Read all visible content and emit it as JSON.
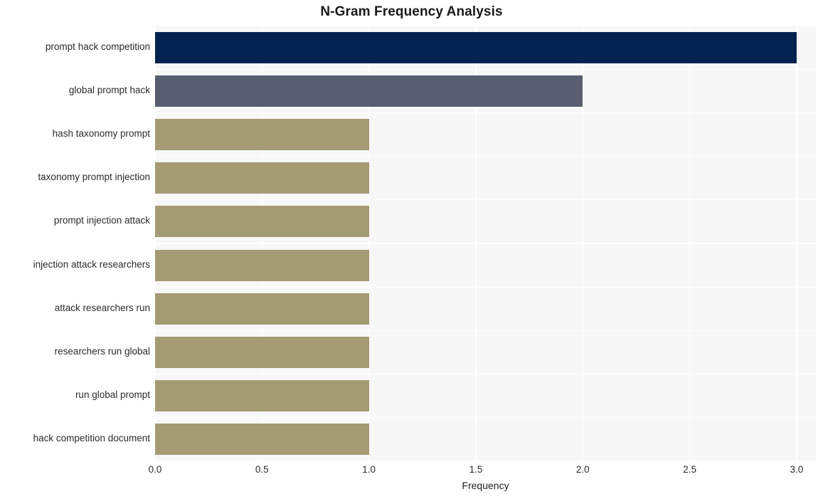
{
  "chart_data": {
    "type": "bar",
    "orientation": "horizontal",
    "title": "N-Gram Frequency Analysis",
    "xlabel": "Frequency",
    "ylabel": "",
    "categories": [
      "prompt hack competition",
      "global prompt hack",
      "hash taxonomy prompt",
      "taxonomy prompt injection",
      "prompt injection attack",
      "injection attack researchers",
      "attack researchers run",
      "researchers run global",
      "run global prompt",
      "hack competition document"
    ],
    "values": [
      3,
      2,
      1,
      1,
      1,
      1,
      1,
      1,
      1,
      1
    ],
    "bar_colors": [
      "#052350",
      "#585e70",
      "#a49a74",
      "#a49a74",
      "#a49a74",
      "#a49a74",
      "#a49a74",
      "#a49a74",
      "#a49a74",
      "#a49a74"
    ],
    "xlim": [
      0,
      3.09
    ],
    "ylim_categories_order": "descending_by_value",
    "xticks": [
      "0.0",
      "0.5",
      "1.0",
      "1.5",
      "2.0",
      "2.5",
      "3.0"
    ],
    "xtick_values": [
      0,
      0.5,
      1,
      1.5,
      2,
      2.5,
      3
    ],
    "grid": true,
    "grid_color": "#ffffff",
    "legend": null,
    "plot_background": "#f7f7f8",
    "figure_background": "#ffffff"
  }
}
